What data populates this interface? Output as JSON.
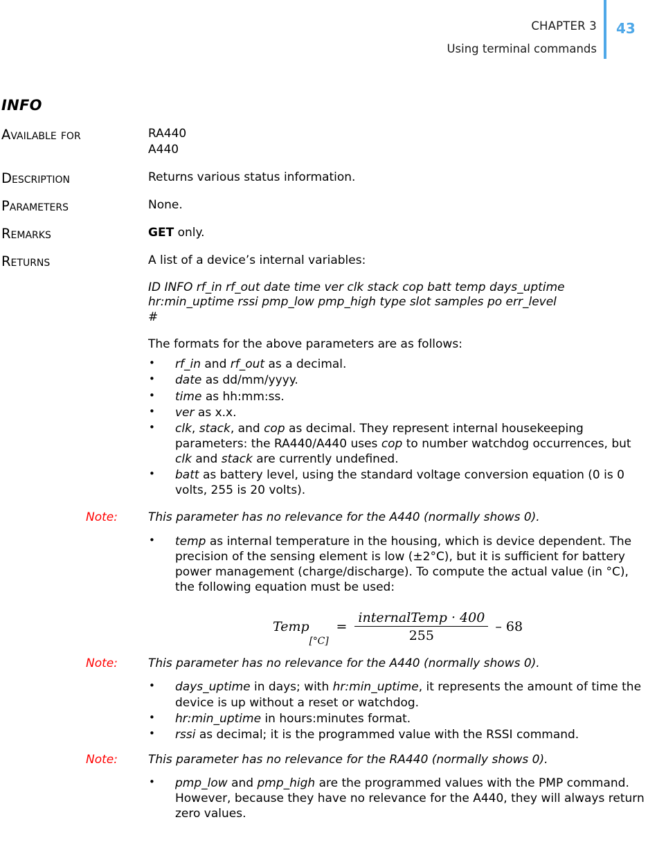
{
  "header": {
    "chapter": "CHAPTER 3",
    "title": "Using terminal commands",
    "page_number": "43",
    "accent_color": "#4FA8E8"
  },
  "command": {
    "name": "INFO",
    "rows": [
      {
        "label": "Available for",
        "values": [
          "RA440",
          "A440"
        ]
      },
      {
        "label": "Description",
        "values": [
          "Returns various status information."
        ]
      },
      {
        "label": "Parameters",
        "values": [
          "None."
        ]
      },
      {
        "label": "Remarks",
        "values_bold_prefix": "GET",
        "values": [
          " only."
        ]
      },
      {
        "label": "Returns",
        "values": [
          "A list of a device’s internal variables:"
        ]
      }
    ],
    "syntax": {
      "line1": "ID INFO rf_in rf_out date time ver clk stack cop batt temp",
      "line2": "days_uptime hr:min_uptime rssi pmp_low pmp_high type slot",
      "line3": "samples po err_level",
      "line4": "#"
    },
    "formats_intro": "The formats for the above parameters are as follows:",
    "bullets_group1": [
      {
        "parts": [
          {
            "text": "rf_in",
            "italic": true
          },
          {
            "text": " and ",
            "italic": false
          },
          {
            "text": "rf_out",
            "italic": true
          },
          {
            "text": " as a decimal.",
            "italic": false
          }
        ]
      },
      {
        "parts": [
          {
            "text": "date",
            "italic": true
          },
          {
            "text": " as dd/mm/yyyy.",
            "italic": false
          }
        ]
      },
      {
        "parts": [
          {
            "text": "time",
            "italic": true
          },
          {
            "text": " as hh:mm:ss.",
            "italic": false
          }
        ]
      },
      {
        "parts": [
          {
            "text": "ver",
            "italic": true
          },
          {
            "text": " as x.x.",
            "italic": false
          }
        ]
      },
      {
        "parts": [
          {
            "text": "clk",
            "italic": true
          },
          {
            "text": ", ",
            "italic": false
          },
          {
            "text": "stack",
            "italic": true
          },
          {
            "text": ", and ",
            "italic": false
          },
          {
            "text": "cop",
            "italic": true
          },
          {
            "text": " as decimal. They represent internal housekeeping parameters: the RA440/A440 uses ",
            "italic": false
          },
          {
            "text": "cop",
            "italic": true
          },
          {
            "text": " to number watchdog occurrences, but ",
            "italic": false
          },
          {
            "text": "clk",
            "italic": true
          },
          {
            "text": " and ",
            "italic": false
          },
          {
            "text": "stack",
            "italic": true
          },
          {
            "text": " are currently undefined.",
            "italic": false
          }
        ]
      },
      {
        "parts": [
          {
            "text": "batt",
            "italic": true
          },
          {
            "text": " as battery level, using the standard voltage conversion equation (0 is 0 volts, 255 is 20 volts).",
            "italic": false
          }
        ]
      }
    ],
    "note1": {
      "label": "Note:",
      "text": "This parameter has no relevance for the A440 (normally shows 0)."
    },
    "bullets_group2": [
      {
        "parts": [
          {
            "text": "temp",
            "italic": true
          },
          {
            "text": " as internal temperature in the housing, which is device dependent. The precision of the sensing element is low (±2°C), but it is sufficient for battery power management (charge/discharge). To compute the actual value (in °C), the following equation must be used:",
            "italic": false
          }
        ]
      }
    ],
    "equation": {
      "lhs": "Temp",
      "lhs_subscript": "[°C]",
      "equals": "=",
      "numerator": "internalTemp · 400",
      "denominator": "255",
      "tail": "– 68",
      "plain": "Temp[°C] = (internalTemp · 400) / 255 – 68"
    },
    "note2": {
      "label": "Note:",
      "text": "This parameter has no relevance for the A440 (normally shows 0)."
    },
    "bullets_group3": [
      {
        "parts": [
          {
            "text": "days_uptime",
            "italic": true
          },
          {
            "text": " in days; with ",
            "italic": false
          },
          {
            "text": "hr:min_uptime",
            "italic": true
          },
          {
            "text": ", it represents the amount of time the device is up without a reset or watchdog.",
            "italic": false
          }
        ]
      },
      {
        "parts": [
          {
            "text": "hr:min_uptime",
            "italic": true
          },
          {
            "text": " in hours:minutes format.",
            "italic": false
          }
        ]
      },
      {
        "parts": [
          {
            "text": "rssi",
            "italic": true
          },
          {
            "text": " as decimal; it is the programmed value with the RSSI command.",
            "italic": false
          }
        ]
      }
    ],
    "note3": {
      "label": "Note:",
      "text": "This parameter has no relevance for the RA440 (normally shows 0)."
    },
    "bullets_group4": [
      {
        "parts": [
          {
            "text": "pmp_low",
            "italic": true
          },
          {
            "text": " and ",
            "italic": false
          },
          {
            "text": "pmp_high",
            "italic": true
          },
          {
            "text": " are the programmed values with the PMP command. However, because they have no relevance for the A440, they will always return zero values.",
            "italic": false
          }
        ]
      }
    ],
    "note_color": "#FF0000"
  }
}
